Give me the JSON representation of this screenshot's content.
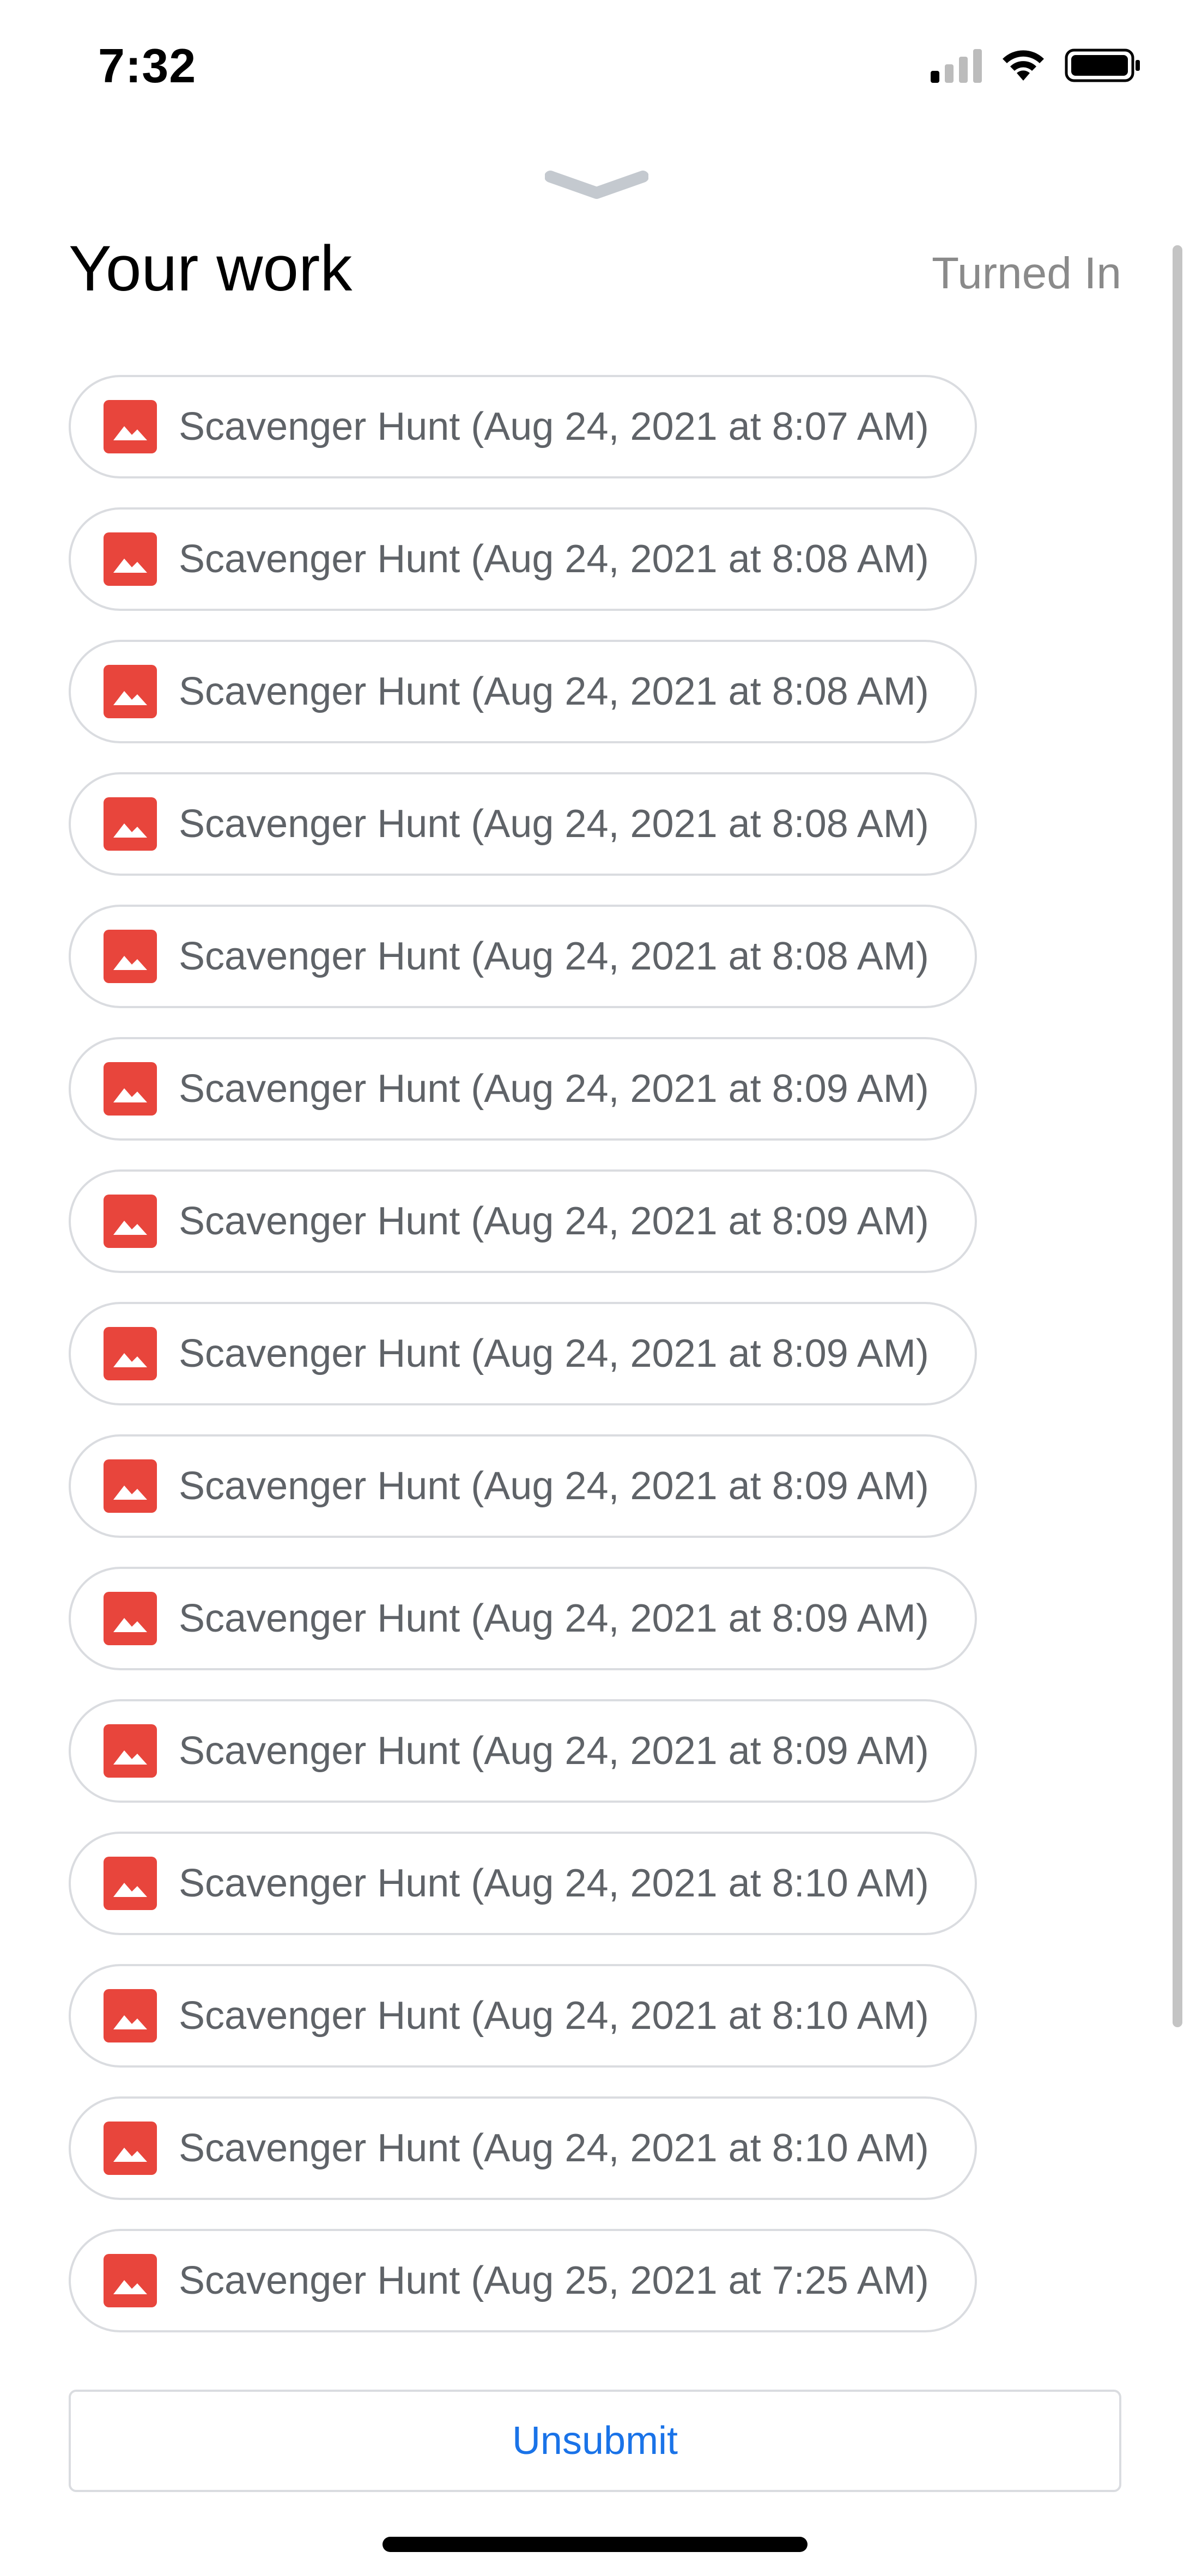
{
  "status_bar": {
    "time": "7:32",
    "icons": [
      "signal-icon",
      "wifi-icon",
      "battery-icon"
    ]
  },
  "header": {
    "title": "Your work",
    "status": "Turned In"
  },
  "work_items": [
    {
      "label": "Scavenger Hunt (Aug 24, 2021 at 8:07 AM)",
      "icon": "image-icon"
    },
    {
      "label": "Scavenger Hunt (Aug 24, 2021 at 8:08 AM)",
      "icon": "image-icon"
    },
    {
      "label": "Scavenger Hunt (Aug 24, 2021 at 8:08 AM)",
      "icon": "image-icon"
    },
    {
      "label": "Scavenger Hunt (Aug 24, 2021 at 8:08 AM)",
      "icon": "image-icon"
    },
    {
      "label": "Scavenger Hunt (Aug 24, 2021 at 8:08 AM)",
      "icon": "image-icon"
    },
    {
      "label": "Scavenger Hunt (Aug 24, 2021 at 8:09 AM)",
      "icon": "image-icon"
    },
    {
      "label": "Scavenger Hunt (Aug 24, 2021 at 8:09 AM)",
      "icon": "image-icon"
    },
    {
      "label": "Scavenger Hunt (Aug 24, 2021 at 8:09 AM)",
      "icon": "image-icon"
    },
    {
      "label": "Scavenger Hunt (Aug 24, 2021 at 8:09 AM)",
      "icon": "image-icon"
    },
    {
      "label": "Scavenger Hunt (Aug 24, 2021 at 8:09 AM)",
      "icon": "image-icon"
    },
    {
      "label": "Scavenger Hunt (Aug 24, 2021 at 8:09 AM)",
      "icon": "image-icon"
    },
    {
      "label": "Scavenger Hunt (Aug 24, 2021 at 8:10 AM)",
      "icon": "image-icon"
    },
    {
      "label": "Scavenger Hunt (Aug 24, 2021 at 8:10 AM)",
      "icon": "image-icon"
    },
    {
      "label": "Scavenger Hunt (Aug 24, 2021 at 8:10 AM)",
      "icon": "image-icon"
    },
    {
      "label": "Scavenger Hunt (Aug 25, 2021 at 7:25 AM)",
      "icon": "image-icon"
    }
  ],
  "actions": {
    "unsubmit_label": "Unsubmit"
  },
  "colors": {
    "accent": "#1a73e8",
    "image_icon": "#e8453c",
    "item_text": "#5f6368",
    "border": "#dadce0"
  }
}
